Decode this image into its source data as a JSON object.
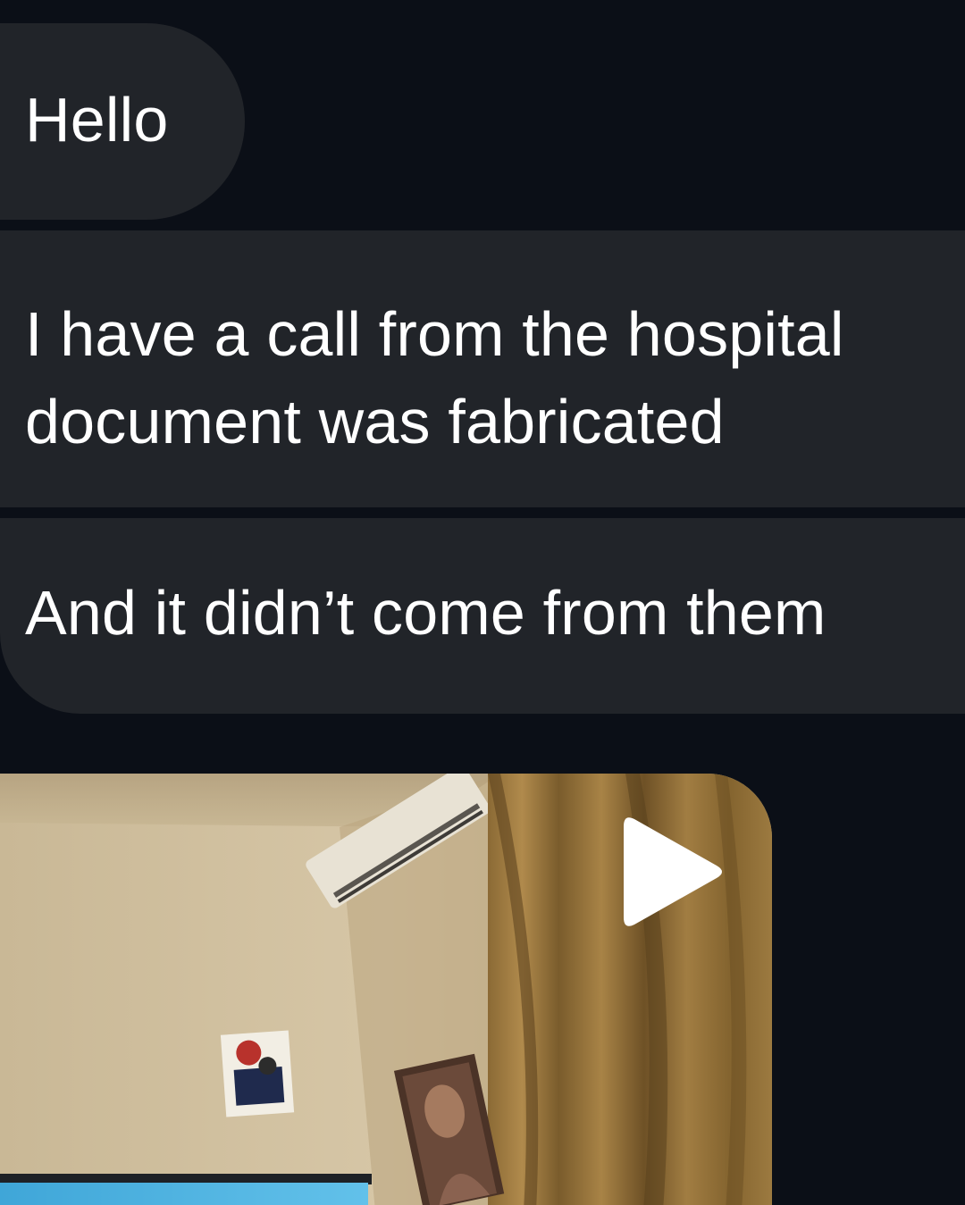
{
  "messages": [
    {
      "lines": [
        "Hello"
      ]
    },
    {
      "lines": [
        "I have a call from the hospital",
        "document was fabricated"
      ]
    },
    {
      "lines": [
        "And it didn’t come from them"
      ]
    }
  ],
  "video": {
    "kind": "video-message",
    "play_icon": "play-icon"
  },
  "colors": {
    "background": "#0b0f17",
    "bubble": "#212429",
    "text": "#ffffff"
  }
}
